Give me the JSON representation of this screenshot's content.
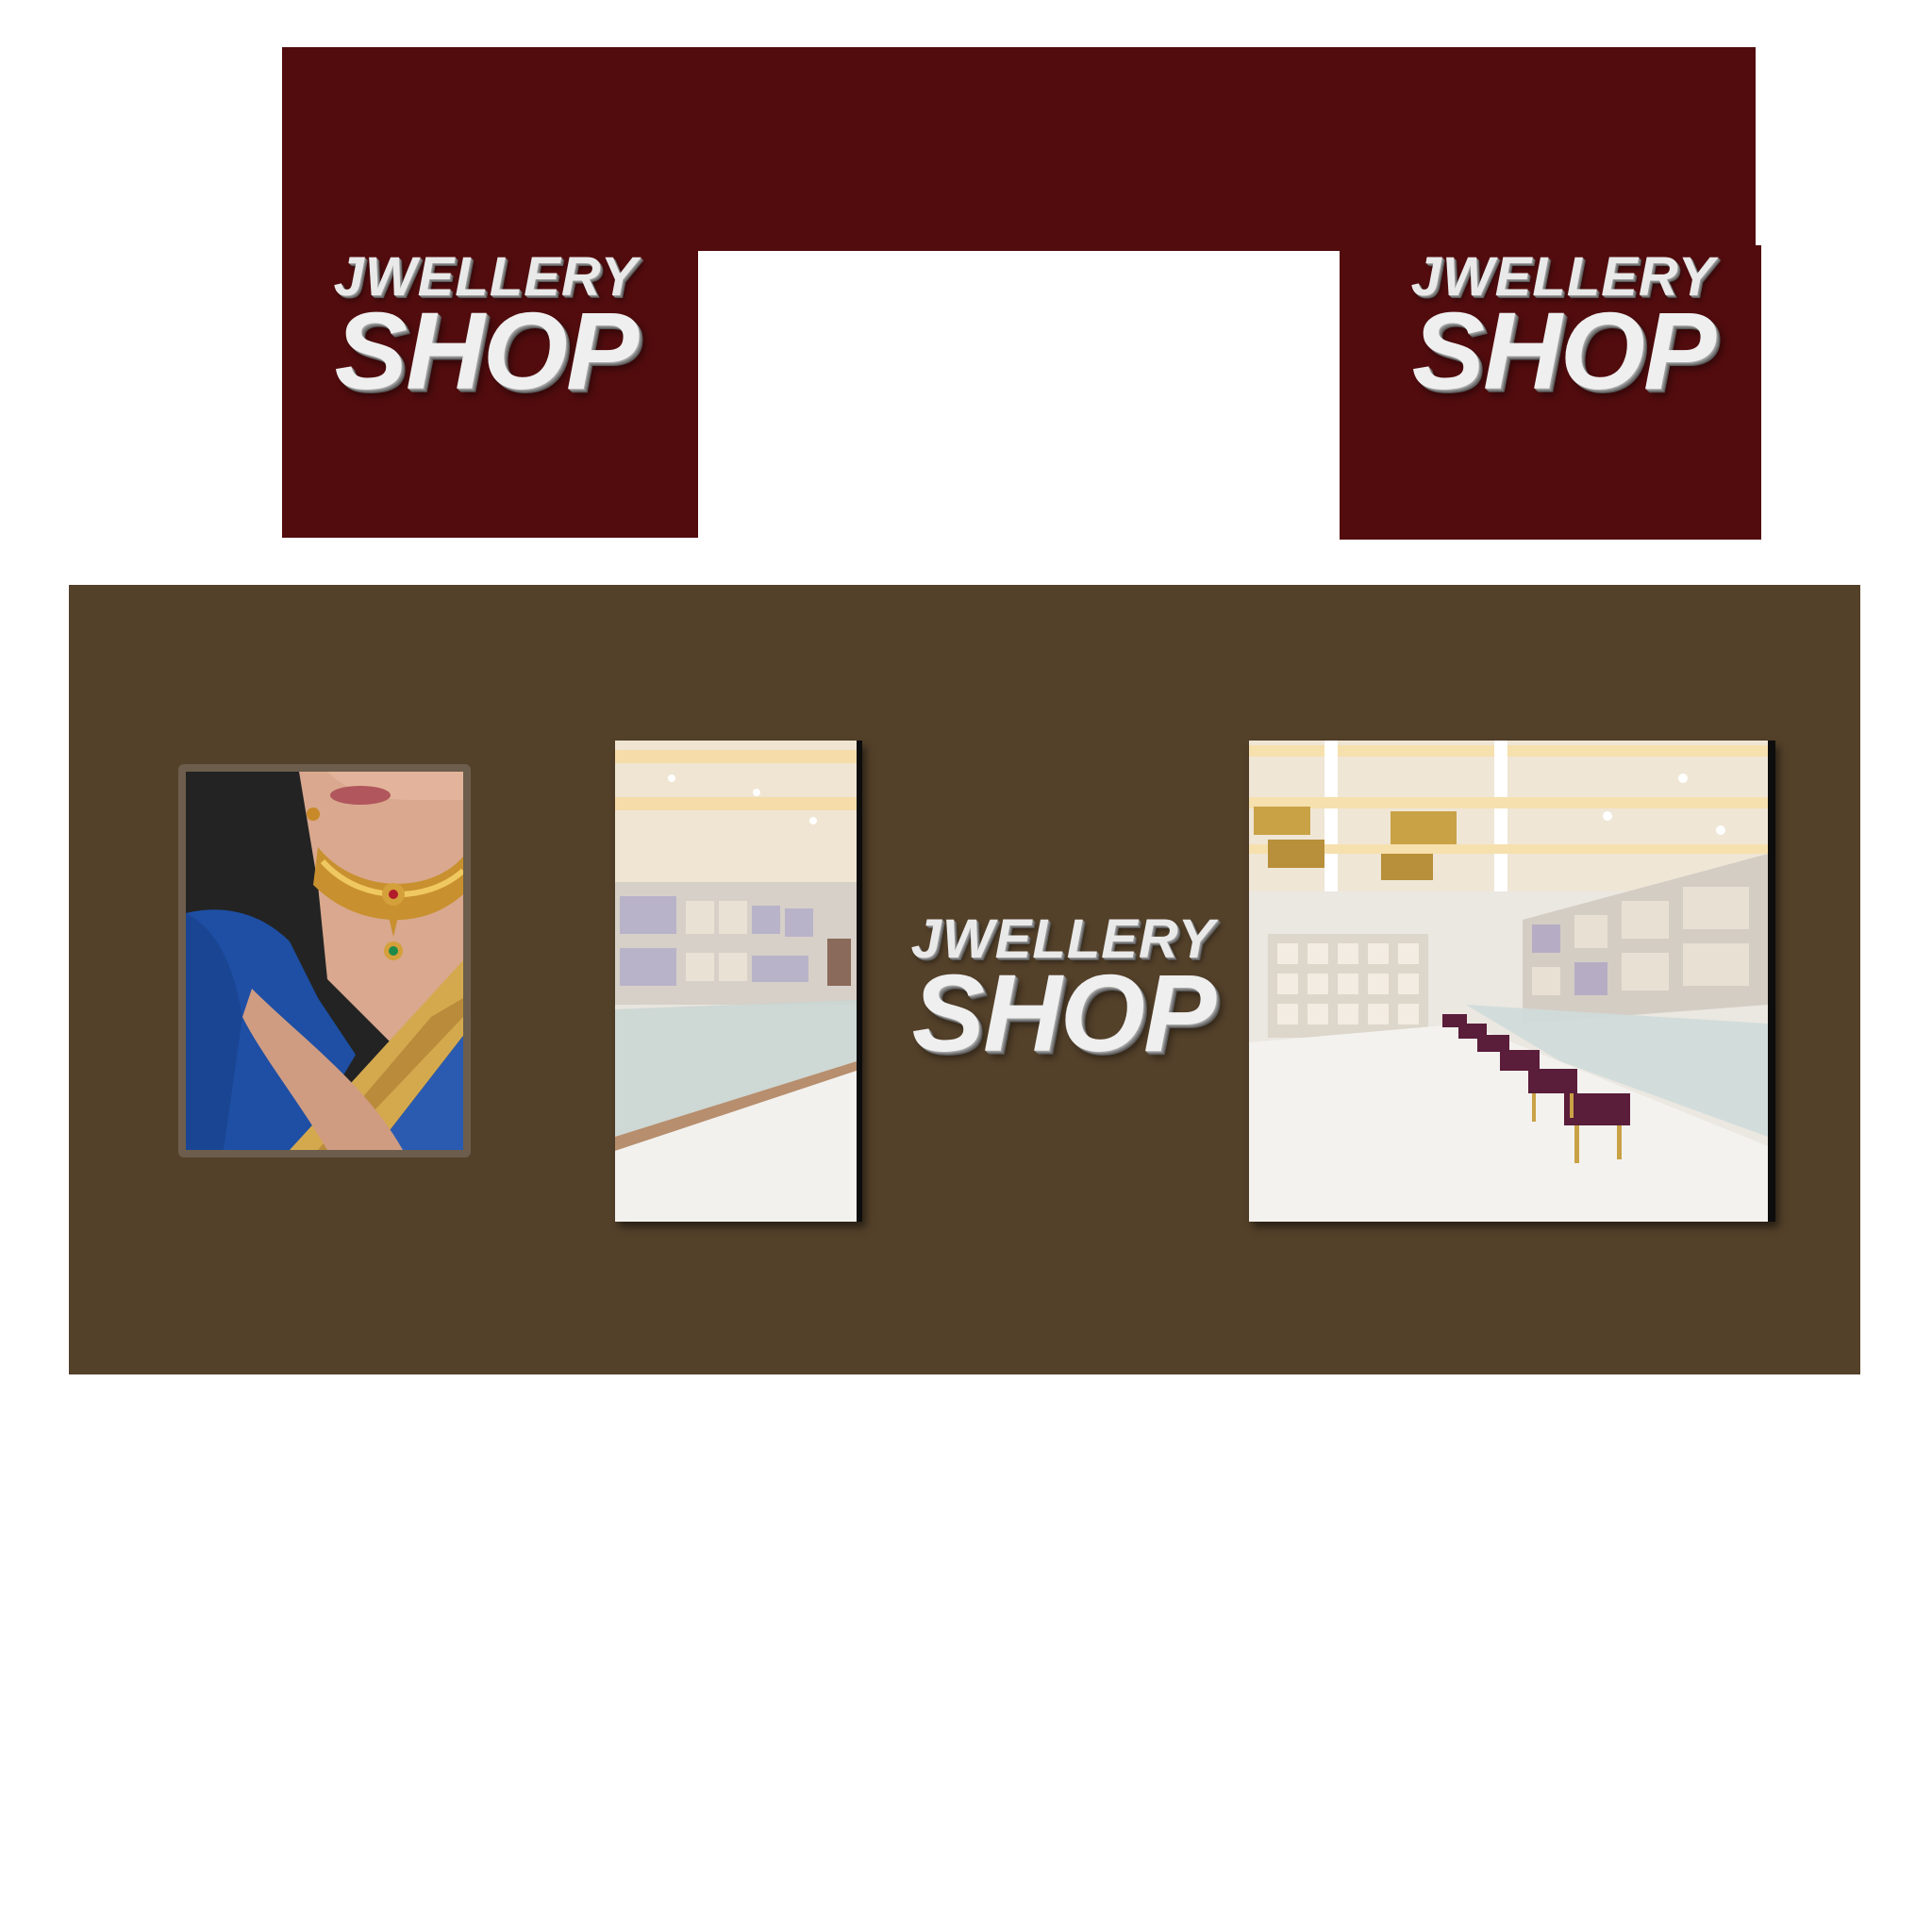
{
  "signage": {
    "left": {
      "line1": "JWELLERY",
      "line2": "SHOP"
    },
    "right": {
      "line1": "JWELLERY",
      "line2": "SHOP"
    },
    "center": {
      "line1": "JWELLERY",
      "line2": "SHOP"
    }
  },
  "colors": {
    "fascia": "#520c0e",
    "wall": "#54412a",
    "background": "#ffffff",
    "logo_text": "#efefef"
  },
  "images": {
    "poster": "model-wearing-gold-choker-necklace-blue-saree",
    "photo_left": "jewellery-store-interior-display-counters",
    "photo_right": "jewellery-store-interior-with-purple-stools-and-chandeliers"
  }
}
